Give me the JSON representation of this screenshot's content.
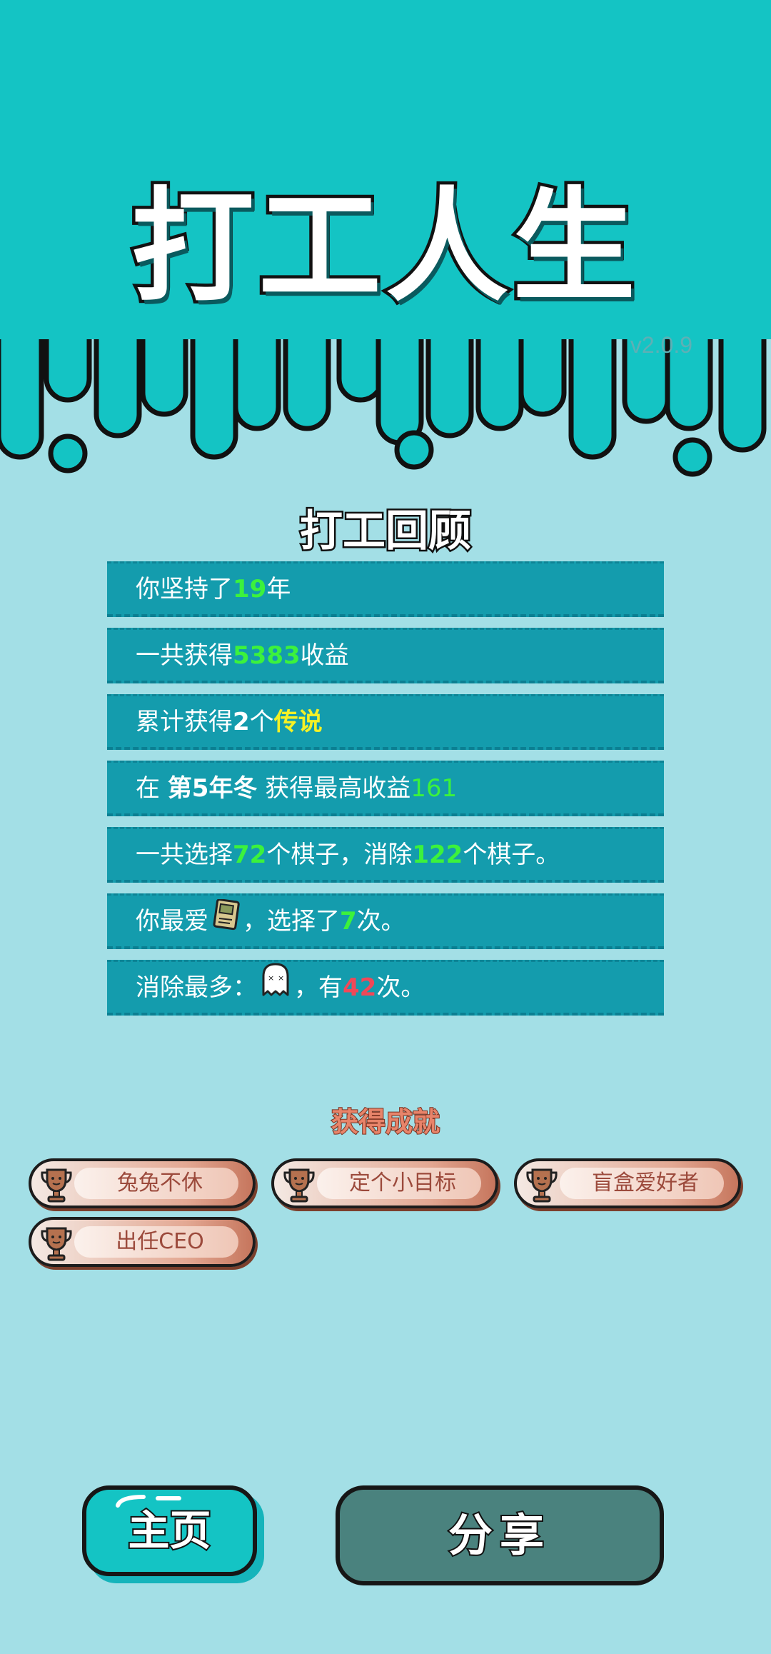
{
  "header": {
    "title": "打工人生",
    "version": "v2.0.9",
    "colors": {
      "top": "#14c4c4",
      "bottom": "#a3dfe6"
    }
  },
  "review": {
    "title": "打工回顾",
    "rows": [
      {
        "pre": "你坚持了",
        "v1": "19",
        "post": "年"
      },
      {
        "pre": "一共获得",
        "v1": "5383",
        "post": "收益"
      },
      {
        "pre": "累计获得",
        "v1": "2",
        "mid": "个",
        "v2": "传说"
      },
      {
        "pre": "在 ",
        "v1": "第5年冬",
        "mid": " 获得最高收益",
        "v2": "161"
      },
      {
        "pre": "一共选择",
        "v1": "72",
        "mid": "个棋子，消除",
        "v2": "122",
        "post": "个棋子。"
      },
      {
        "pre": "你最爱",
        "icon": "card-icon",
        "mid": "，选择了",
        "v1": "7",
        "post": "次。"
      },
      {
        "pre": "消除最多：",
        "icon": "ghost-icon",
        "mid": "，有",
        "v1": "42",
        "post": "次。"
      }
    ]
  },
  "achievements": {
    "title": "获得成就",
    "items": [
      "兔兔不休",
      "定个小目标",
      "盲盒爱好者",
      "出任CEO"
    ],
    "icon": "trophy-icon"
  },
  "buttons": {
    "home": "主页",
    "share": "分享"
  }
}
